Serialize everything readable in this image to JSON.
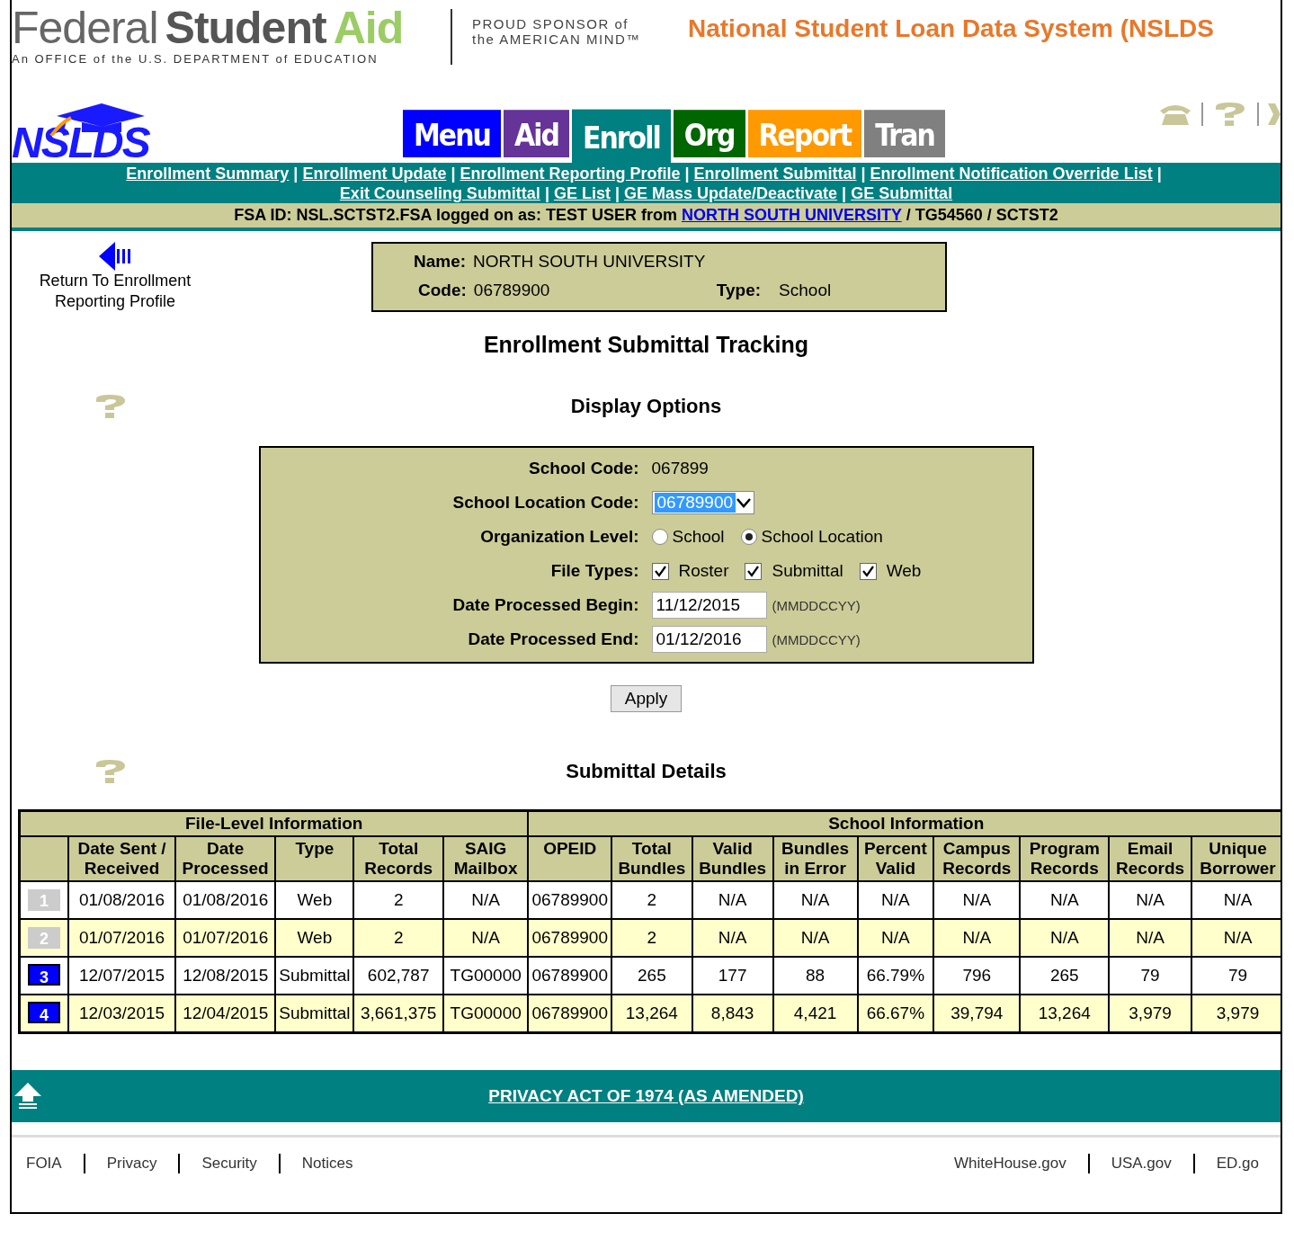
{
  "header": {
    "brand_words": [
      "Federal",
      "Student",
      "Aid"
    ],
    "brand_subtitle": "An OFFICE of the U.S. DEPARTMENT of EDUCATION",
    "sponsor_lines": [
      "PROUD SPONSOR of",
      "the AMERICAN MIND™"
    ],
    "system_title": "National Student Loan Data System (NSLDS",
    "logo_text": "NSLDS"
  },
  "tabs": [
    {
      "label": "Menu",
      "color": "#0000ff",
      "selected": false
    },
    {
      "label": "Aid",
      "color": "#663399",
      "selected": false
    },
    {
      "label": "Enroll",
      "color": "#008080",
      "selected": true
    },
    {
      "label": "Org",
      "color": "#006600",
      "selected": false
    },
    {
      "label": "Report",
      "color": "#ff9900",
      "selected": false
    },
    {
      "label": "Tran",
      "color": "#808080",
      "selected": false
    }
  ],
  "subnav": {
    "lines": [
      [
        {
          "label": "Enrollment Summary",
          "trail": "|"
        },
        {
          "label": "Enrollment Update",
          "trail": "|"
        },
        {
          "label": "Enrollment Reporting Profile",
          "trail": "|"
        },
        {
          "label": "Enrollment Submittal",
          "trail": "|"
        },
        {
          "label": "Enrollment Notification Override List",
          "trail": "|"
        }
      ],
      [
        {
          "label": "Exit Counseling Submittal",
          "trail": "|"
        },
        {
          "label": "GE List",
          "trail": "|"
        },
        {
          "label": "GE Mass Update/Deactivate",
          "trail": "|"
        },
        {
          "label": "GE Submittal"
        }
      ]
    ]
  },
  "login_bar": {
    "prefix": "FSA ID: NSL.SCTST2.FSA logged on as: TEST USER from",
    "school_link": "NORTH SOUTH UNIVERSITY",
    "suffix": "/ TG54560 / SCTST2"
  },
  "return_link": "Return To Enrollment Reporting Profile",
  "school_box": {
    "name_label": "Name:",
    "name": "NORTH SOUTH UNIVERSITY",
    "code_label": "Code:",
    "code": "06789900",
    "type_label": "Type:",
    "type": "School"
  },
  "page_title": "Enrollment Submittal Tracking",
  "display_options": {
    "title": "Display Options",
    "school_code_label": "School Code:",
    "school_code": "067899",
    "location_label": "School Location Code:",
    "location_value": "06789900",
    "org_label": "Organization Level:",
    "org_options": [
      {
        "label": "School",
        "selected": false
      },
      {
        "label": "School Location",
        "selected": true
      }
    ],
    "file_types_label": "File Types:",
    "file_types": [
      {
        "label": "Roster",
        "checked": true
      },
      {
        "label": "Submittal",
        "checked": true
      },
      {
        "label": "Web",
        "checked": true
      }
    ],
    "begin_label": "Date Processed Begin:",
    "begin_value": "11/12/2015",
    "end_label": "Date Processed End:",
    "end_value": "01/12/2016",
    "begin_hint": "(MMDDCCYY)",
    "end_hint": "(MMDDCCYY)",
    "apply": "Apply"
  },
  "details": {
    "title": "Submittal Details",
    "groups": [
      "File-Level Information",
      "School Information"
    ],
    "columns": [
      "Date Sent / Received",
      "Date Processed",
      "Type",
      "Total Records",
      "SAIG Mailbox",
      "OPEID",
      "Total Bundles",
      "Valid Bundles",
      "Bundles in Error",
      "Percent Valid",
      "Campus Records",
      "Program Records",
      "Email Records",
      "Unique Borrower"
    ],
    "rows": [
      {
        "number": "1",
        "disabled": true,
        "cells": [
          "01/08/2016",
          "01/08/2016",
          "Web",
          "2",
          "N/A",
          "06789900",
          "2",
          "N/A",
          "N/A",
          "N/A",
          "N/A",
          "N/A",
          "N/A",
          "N/A"
        ]
      },
      {
        "number": "2",
        "disabled": true,
        "cells": [
          "01/07/2016",
          "01/07/2016",
          "Web",
          "2",
          "N/A",
          "06789900",
          "2",
          "N/A",
          "N/A",
          "N/A",
          "N/A",
          "N/A",
          "N/A",
          "N/A"
        ]
      },
      {
        "number": "3",
        "disabled": false,
        "cells": [
          "12/07/2015",
          "12/08/2015",
          "Submittal",
          "602,787",
          "TG00000",
          "06789900",
          "265",
          "177",
          "88",
          "66.79%",
          "796",
          "265",
          "79",
          "79"
        ]
      },
      {
        "number": "4",
        "disabled": false,
        "cells": [
          "12/03/2015",
          "12/04/2015",
          "Submittal",
          "3,661,375",
          "TG00000",
          "06789900",
          "13,264",
          "8,843",
          "4,421",
          "66.67%",
          "39,794",
          "13,264",
          "3,979",
          "3,979"
        ]
      }
    ]
  },
  "privacy_link": "PRIVACY ACT OF 1974 (AS AMENDED)",
  "footer": {
    "left_links": [
      "FOIA",
      "Privacy",
      "Security",
      "Notices"
    ],
    "right_links": [
      "WhiteHouse.gov",
      "USA.gov",
      "ED.go"
    ]
  }
}
